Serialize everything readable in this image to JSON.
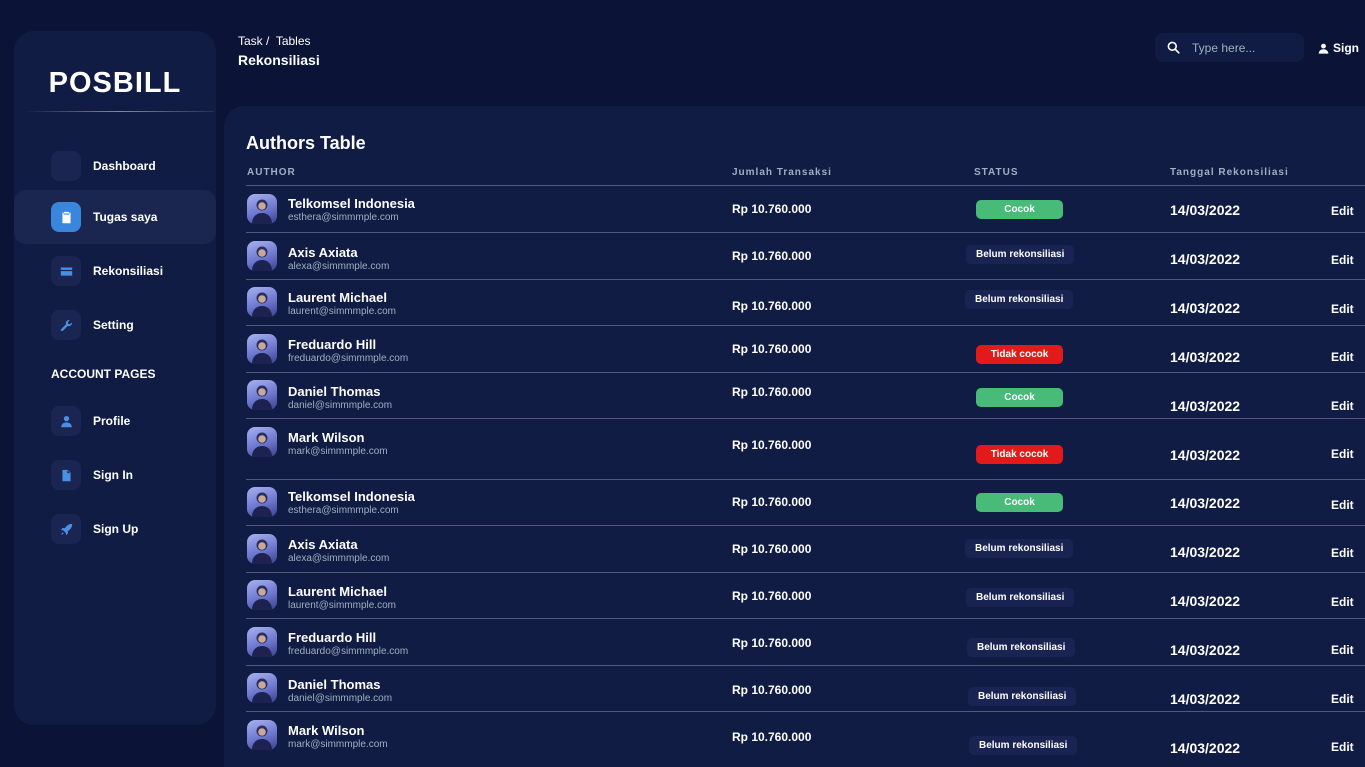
{
  "sidebar": {
    "logo": "POSBILL",
    "items": [
      {
        "label": "Dashboard",
        "icon": "dashboard-icon"
      },
      {
        "label": "Tugas saya",
        "icon": "clipboard-icon"
      },
      {
        "label": "Rekonsiliasi",
        "icon": "credit-card-icon"
      },
      {
        "label": "Setting",
        "icon": "wrench-icon"
      }
    ],
    "section_title": "ACCOUNT PAGES",
    "account_items": [
      {
        "label": "Profile",
        "icon": "person-icon"
      },
      {
        "label": "Sign In",
        "icon": "document-icon"
      },
      {
        "label": "Sign Up",
        "icon": "rocket-icon"
      }
    ]
  },
  "header": {
    "breadcrumb": {
      "root": "Task",
      "separator": " /  ",
      "current": "Tables"
    },
    "title": "Rekonsiliasi",
    "search_placeholder": "Type here...",
    "sign_label": "Sign"
  },
  "table": {
    "title": "Authors Table",
    "columns": {
      "author": "AUTHOR",
      "amount": "Jumlah Transaksi",
      "status": "STATUS",
      "date": "Tanggal Rekonsiliasi"
    },
    "edit_label": "Edit",
    "rows": [
      {
        "name": "Telkomsel Indonesia",
        "email": "esthera@simmmple.com",
        "amount": "Rp 10.760.000",
        "status": "Cocok",
        "date": "14/03/2022"
      },
      {
        "name": "Axis Axiata",
        "email": "alexa@simmmple.com",
        "amount": "Rp 10.760.000",
        "status": "Belum rekonsiliasi",
        "date": "14/03/2022"
      },
      {
        "name": "Laurent Michael",
        "email": "laurent@simmmple.com",
        "amount": "Rp 10.760.000",
        "status": "Belum rekonsiliasi",
        "date": "14/03/2022"
      },
      {
        "name": "Freduardo Hill",
        "email": "freduardo@simmmple.com",
        "amount": "Rp 10.760.000",
        "status": "Tidak cocok",
        "date": "14/03/2022"
      },
      {
        "name": "Daniel Thomas",
        "email": "daniel@simmmple.com",
        "amount": "Rp 10.760.000",
        "status": "Cocok",
        "date": "14/03/2022"
      },
      {
        "name": "Mark Wilson",
        "email": "mark@simmmple.com",
        "amount": "Rp 10.760.000",
        "status": "Tidak cocok",
        "date": "14/03/2022"
      },
      {
        "name": "Telkomsel Indonesia",
        "email": "esthera@simmmple.com",
        "amount": "Rp 10.760.000",
        "status": "Cocok",
        "date": "14/03/2022"
      },
      {
        "name": "Axis Axiata",
        "email": "alexa@simmmple.com",
        "amount": "Rp 10.760.000",
        "status": "Belum rekonsiliasi",
        "date": "14/03/2022"
      },
      {
        "name": "Laurent Michael",
        "email": "laurent@simmmple.com",
        "amount": "Rp 10.760.000",
        "status": "Belum rekonsiliasi",
        "date": "14/03/2022"
      },
      {
        "name": "Freduardo Hill",
        "email": "freduardo@simmmple.com",
        "amount": "Rp 10.760.000",
        "status": "Belum rekonsiliasi",
        "date": "14/03/2022"
      },
      {
        "name": "Daniel Thomas",
        "email": "daniel@simmmple.com",
        "amount": "Rp 10.760.000",
        "status": "Belum rekonsiliasi",
        "date": "14/03/2022"
      },
      {
        "name": "Mark Wilson",
        "email": "mark@simmmple.com",
        "amount": "Rp 10.760.000",
        "status": "Belum rekonsiliasi",
        "date": "14/03/2022"
      }
    ]
  },
  "colors": {
    "background": "#0b1437",
    "card": "#111c44",
    "accent": "#3b86dd",
    "success": "#48bb78",
    "danger": "#e31a1a"
  }
}
